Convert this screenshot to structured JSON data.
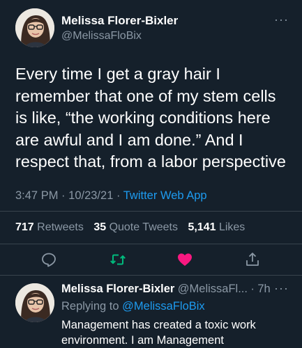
{
  "tweet": {
    "author_name": "Melissa Florer-Bixler",
    "author_handle": "@MelissaFloBix",
    "more_label": "···",
    "text": "Every time I get a gray hair I remember that one of my stem cells is like, “the working conditions here are awful and I am done.” And I respect that, from a labor perspective",
    "time": "3:47 PM",
    "date": "10/23/21",
    "sep": "·",
    "source": "Twitter Web App"
  },
  "stats": {
    "retweets_count": "717",
    "retweets_label": "Retweets",
    "quotes_count": "35",
    "quotes_label": "Quote Tweets",
    "likes_count": "5,141",
    "likes_label": "Likes"
  },
  "actions": [
    {
      "name": "reply",
      "icon": "reply-icon"
    },
    {
      "name": "retweet",
      "icon": "retweet-icon"
    },
    {
      "name": "like",
      "icon": "heart-icon"
    },
    {
      "name": "share",
      "icon": "share-icon"
    }
  ],
  "reply": {
    "author_name": "Melissa Florer-Bixler",
    "author_handle": "@MelissaFl...",
    "sep": "·",
    "age": "7h",
    "more_label": "···",
    "replying_prefix": "Replying to",
    "replying_to": "@MelissaFloBix",
    "text": "Management has created a toxic work environment. I am Management"
  },
  "colors": {
    "background": "#15202b",
    "secondary_text": "#8b98a5",
    "link": "#1d9bf0",
    "retweet": "#00ba7c",
    "like": "#f91880",
    "divider": "#38444d"
  }
}
